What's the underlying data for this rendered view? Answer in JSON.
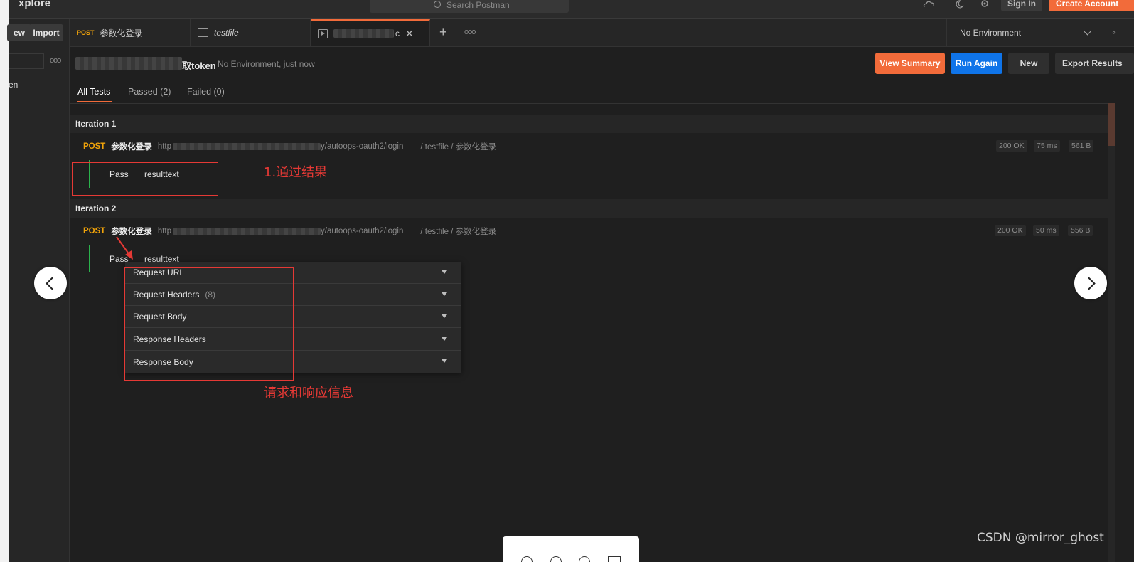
{
  "topbar": {
    "brand": "xplore",
    "search_placeholder": "Search Postman",
    "sign_in": "Sign In",
    "create_account": "Create Account"
  },
  "sidebar": {
    "new_label": "ew",
    "import_label": "Import",
    "more_label": "ooo",
    "item_label": "en"
  },
  "tabs": [
    {
      "method": "POST",
      "title": "参数化登录"
    },
    {
      "title": "testfile"
    },
    {
      "title": "c"
    }
  ],
  "tabbar": {
    "more_label": "ooo",
    "environment": "No Environment"
  },
  "runner": {
    "name_suffix": "取token",
    "meta": "No Environment, just now",
    "view_summary": "View Summary",
    "run_again": "Run Again",
    "new_label": "New",
    "export_results": "Export Results"
  },
  "filters": {
    "all": "All Tests",
    "passed": "Passed (2)",
    "failed": "Failed (0)"
  },
  "iterations": [
    {
      "label": "Iteration 1",
      "method": "POST",
      "name": "参数化登录",
      "url_prefix": "http",
      "url_suffix": "y/autoops-oauth2/login",
      "path": "/ testfile / 参数化登录",
      "status": "200 OK",
      "time": "75 ms",
      "size": "561 B",
      "result": "Pass",
      "test_name": "resulttext"
    },
    {
      "label": "Iteration 2",
      "method": "POST",
      "name": "参数化登录",
      "url_prefix": "http",
      "url_suffix": "y/autoops-oauth2/login",
      "path": "/ testfile / 参数化登录",
      "status": "200 OK",
      "time": "50 ms",
      "size": "556 B",
      "result": "Pass",
      "test_name": "resulttext"
    }
  ],
  "details": {
    "request_url": "Request URL",
    "request_headers": "Request Headers",
    "request_headers_count": "(8)",
    "request_body": "Request Body",
    "response_headers": "Response Headers",
    "response_body": "Response Body"
  },
  "annotations": {
    "pass_result": "1.通过结果",
    "req_resp_info": "请求和响应信息"
  },
  "watermark": "CSDN @mirror_ghost",
  "colors": {
    "accent": "#f26b3a",
    "primary": "#0f74e9",
    "pass": "#2bb24c",
    "annotation": "#e53935",
    "method_post": "#f0a30a"
  }
}
